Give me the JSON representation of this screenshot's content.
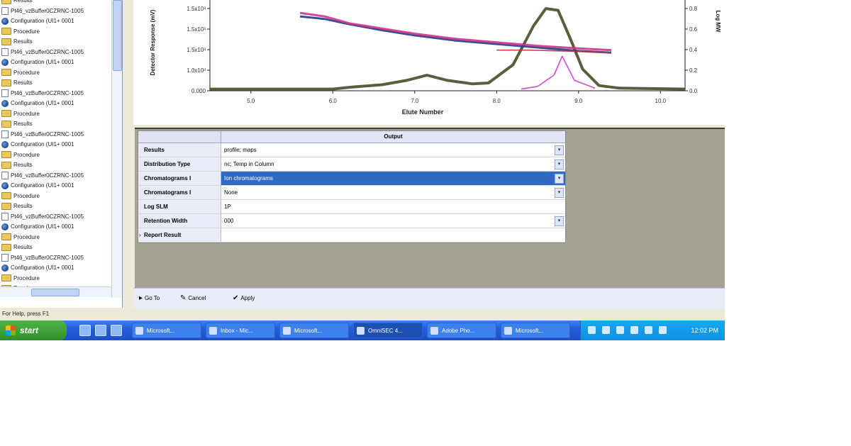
{
  "tree": {
    "items": [
      {
        "icon": "folder",
        "label": "Results"
      },
      {
        "icon": "doc",
        "label": "Pt46_vzBuffer0CZRNC-1005"
      },
      {
        "icon": "config",
        "label": "Configuration (UI1+ 0001"
      },
      {
        "icon": "folder",
        "label": "Procedure"
      },
      {
        "icon": "folder",
        "label": "Results"
      },
      {
        "icon": "doc",
        "label": "Pt46_vzBuffer0CZRNC-1005"
      },
      {
        "icon": "config",
        "label": "Configuration (UI1+ 0001"
      },
      {
        "icon": "folder",
        "label": "Procedure"
      },
      {
        "icon": "folder",
        "label": "Results"
      },
      {
        "icon": "doc",
        "label": "Pt46_vzBuffer0CZRNC-1005"
      },
      {
        "icon": "config",
        "label": "Configuration (UI1+ 0001"
      },
      {
        "icon": "folder",
        "label": "Procedure"
      },
      {
        "icon": "folder",
        "label": "Results"
      },
      {
        "icon": "doc",
        "label": "Pt46_vzBuffer0CZRNC-1005"
      },
      {
        "icon": "config",
        "label": "Configuration (UI1+ 0001"
      },
      {
        "icon": "folder",
        "label": "Procedure"
      },
      {
        "icon": "folder",
        "label": "Results"
      },
      {
        "icon": "doc",
        "label": "Pt46_vzBuffer0CZRNC-1005"
      },
      {
        "icon": "config",
        "label": "Configuration (UI1+ 0001"
      },
      {
        "icon": "folder",
        "label": "Procedure"
      },
      {
        "icon": "folder",
        "label": "Results"
      },
      {
        "icon": "doc",
        "label": "Pt46_vzBuffer0CZRNC-1005"
      },
      {
        "icon": "config",
        "label": "Configuration (UI1+ 0001"
      },
      {
        "icon": "folder",
        "label": "Procedure"
      },
      {
        "icon": "folder",
        "label": "Results"
      },
      {
        "icon": "doc",
        "label": "Pt46_vzBuffer0CZRNC-1005"
      },
      {
        "icon": "config",
        "label": "Configuration (UI1+ 0001"
      },
      {
        "icon": "folder",
        "label": "Procedure"
      },
      {
        "icon": "folder",
        "label": "Results"
      }
    ],
    "status": "For Help, press F1"
  },
  "chart": {
    "xlabel": "Elute Number",
    "x_ticks": [
      "5.0",
      "6.0",
      "7.0",
      "8.0",
      "9.0",
      "10.0"
    ],
    "y_ticks": [
      "0.000",
      "1.0x10³",
      "1.5x10³",
      "1.5x10³",
      "1.5x10³"
    ],
    "y2_ticks": [
      "0.0",
      "0.2",
      "0.4",
      "0.6",
      "0.8"
    ],
    "ylabel_left": "Detector Response (mV)",
    "ylabel_right": "Log MW"
  },
  "chart_data": {
    "type": "line",
    "xlim": [
      4.5,
      10.3
    ],
    "ylim": [
      0,
      1.0
    ],
    "y2lim": [
      0,
      1.0
    ],
    "xlabel": "Elute Number",
    "series": [
      {
        "color": "#4a4a2a",
        "axis": "left",
        "x": [
          4.5,
          6.0,
          6.2,
          6.6,
          6.9,
          7.15,
          7.4,
          7.7,
          7.9,
          8.2,
          8.45,
          8.6,
          8.75,
          8.9,
          9.05,
          9.25,
          9.5,
          10.3
        ],
        "y": [
          0.02,
          0.02,
          0.04,
          0.07,
          0.12,
          0.18,
          0.12,
          0.08,
          0.09,
          0.3,
          0.75,
          0.95,
          0.93,
          0.6,
          0.25,
          0.06,
          0.03,
          0.02
        ]
      },
      {
        "color": "#1f3d8a",
        "axis": "right",
        "x": [
          5.6,
          5.9,
          6.2,
          6.6,
          7.0,
          7.5,
          8.0,
          8.5,
          9.0,
          9.4
        ],
        "y": [
          0.86,
          0.83,
          0.77,
          0.7,
          0.64,
          0.58,
          0.54,
          0.5,
          0.46,
          0.44
        ]
      },
      {
        "color": "#d0338a",
        "axis": "right",
        "x": [
          5.6,
          5.9,
          6.2,
          6.6,
          7.0,
          7.5,
          8.0,
          8.5,
          9.0,
          9.4
        ],
        "y": [
          0.9,
          0.86,
          0.78,
          0.72,
          0.66,
          0.6,
          0.56,
          0.52,
          0.49,
          0.47
        ]
      },
      {
        "color": "#c03030",
        "axis": "right",
        "x": [
          8.0,
          8.4,
          8.8,
          9.2,
          9.4
        ],
        "y": [
          0.47,
          0.47,
          0.46,
          0.45,
          0.44
        ]
      },
      {
        "color": "#c83cc8",
        "axis": "left",
        "x": [
          8.3,
          8.5,
          8.7,
          8.8,
          8.95,
          9.2
        ],
        "y": [
          0.02,
          0.05,
          0.18,
          0.4,
          0.12,
          0.03
        ]
      }
    ]
  },
  "grid": {
    "header": "Output",
    "rows": [
      {
        "name": "Results",
        "value": "profile; maps",
        "dropdown": true
      },
      {
        "name": "Distribution Type",
        "value": "nc; Temp in Column",
        "dropdown": true
      },
      {
        "name": "Chromatograms I",
        "value": "Ion chromatograms",
        "dropdown": true,
        "selected": true
      },
      {
        "name": "Chromatograms I",
        "value": "None",
        "dropdown": true
      },
      {
        "name": "Log SLM",
        "value": "1P",
        "dropdown": false
      },
      {
        "name": "Retention Width",
        "value": "000",
        "dropdown": true
      },
      {
        "name": "Report Result",
        "value": "",
        "dropdown": false,
        "expander": true
      }
    ]
  },
  "toolbar": {
    "buttons": [
      {
        "icon": "run-icon",
        "label": "Go To"
      },
      {
        "icon": "edit-icon",
        "label": "Cancel"
      },
      {
        "icon": "apply-icon",
        "label": "Apply"
      }
    ]
  },
  "taskbar": {
    "start_label": "start",
    "tasks": [
      {
        "label": "Microsoft..."
      },
      {
        "label": "Inbox - Mic..."
      },
      {
        "label": "Microsoft..."
      },
      {
        "label": "OmniSEC 4...",
        "active": true
      },
      {
        "label": "Adobe Pho..."
      },
      {
        "label": "Microsoft..."
      }
    ],
    "clock": "12:02 PM"
  }
}
